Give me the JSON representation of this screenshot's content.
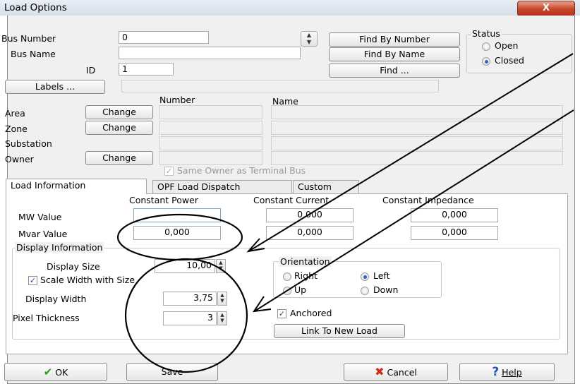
{
  "window": {
    "title": "Load Options",
    "close_glyph": "X"
  },
  "bus": {
    "number_label": "Bus Number",
    "number_value": "0",
    "name_label": "Bus Name",
    "name_value": "",
    "id_label": "ID",
    "id_value": "1",
    "labels_button": "Labels ...",
    "labels_value": ""
  },
  "find_buttons": {
    "by_number": "Find By Number",
    "by_name": "Find By Name",
    "find": "Find ..."
  },
  "status": {
    "title": "Status",
    "open": "Open",
    "closed": "Closed",
    "selected": "Closed"
  },
  "assignment": {
    "col_number": "Number",
    "col_name": "Name",
    "rows": [
      {
        "label": "Area",
        "button": "Change",
        "number": "",
        "name": ""
      },
      {
        "label": "Zone",
        "button": "Change",
        "number": "",
        "name": ""
      },
      {
        "label": "Substation",
        "button": "",
        "number": "",
        "name": ""
      },
      {
        "label": "Owner",
        "button": "Change",
        "number": "",
        "name": ""
      }
    ],
    "same_owner": "Same Owner as Terminal Bus"
  },
  "tabs": [
    "Load Information",
    "OPF Load Dispatch",
    "Custom"
  ],
  "load_info": {
    "col_power": "Constant Power",
    "col_current": "Constant Current",
    "col_impedance": "Constant Impedance",
    "mw_label": "MW Value",
    "mvar_label": "Mvar Value",
    "mw": {
      "power": "",
      "current": "0,000",
      "impedance": "0,000"
    },
    "mvar": {
      "power": "0,000",
      "current": "0,000",
      "impedance": "0,000"
    }
  },
  "display": {
    "group_title": "Display Information",
    "size_label": "Display Size",
    "size_value": "10,00",
    "scale_label": "Scale Width with Size",
    "width_label": "Display Width",
    "width_value": "3,75",
    "pixel_label": "Pixel Thickness",
    "pixel_value": "3"
  },
  "orientation": {
    "title": "Orientation",
    "right": "Right",
    "left": "Left",
    "up": "Up",
    "down": "Down",
    "selected": "Left",
    "anchored": "Anchored",
    "link_button": "Link To New Load"
  },
  "footer": {
    "ok": "OK",
    "save": "Save",
    "cancel": "Cancel",
    "help": "Help"
  },
  "icons": {
    "ok": "check-icon",
    "cancel": "x-icon",
    "help": "question-icon",
    "spin": "spin-arrows-icon"
  },
  "colors": {
    "title_gradient_top": "#e9eef6",
    "close_button": "#c9452a",
    "dialog_bg": "#f0f0f0",
    "annotation": "#000000"
  }
}
